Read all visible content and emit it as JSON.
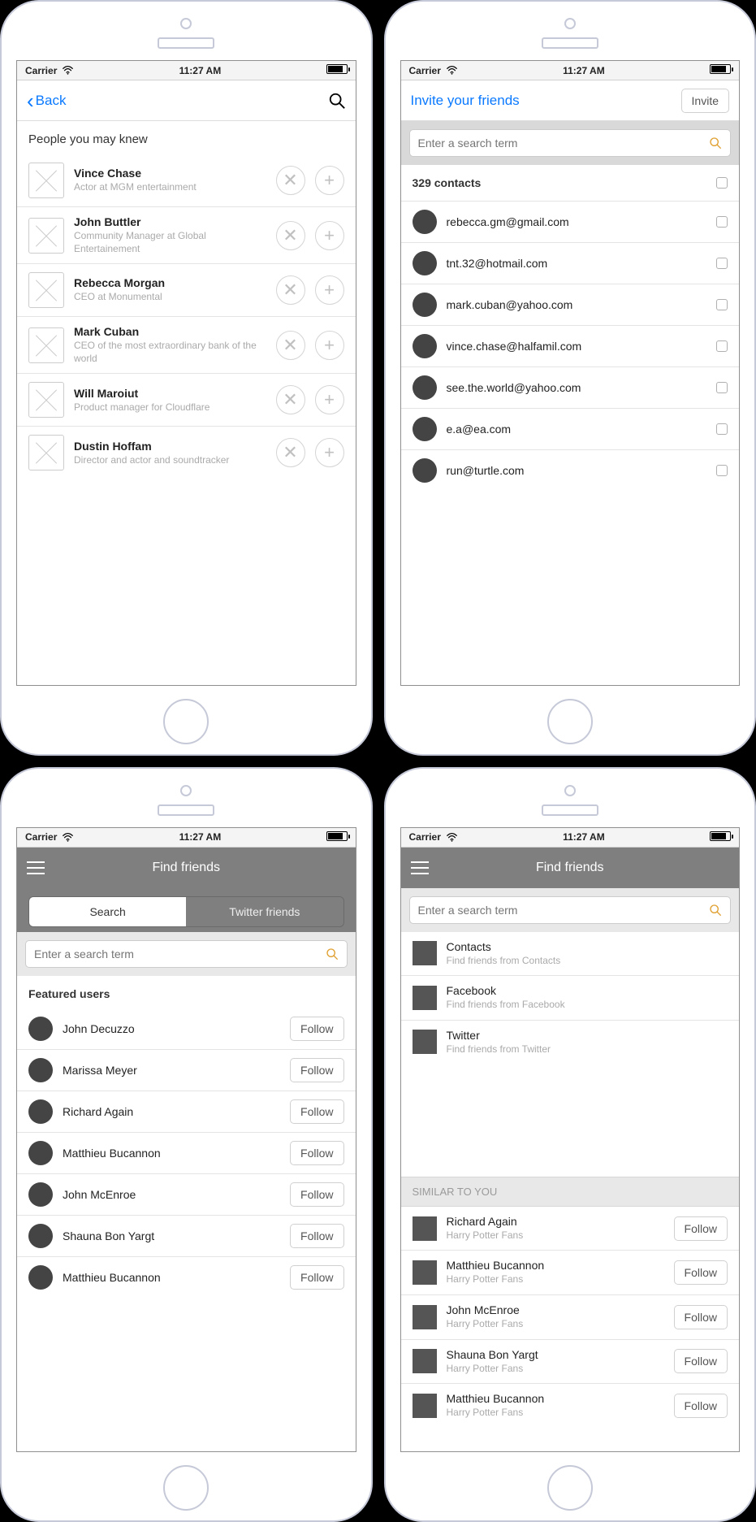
{
  "status": {
    "carrier": "Carrier",
    "time": "11:27 AM"
  },
  "screen1": {
    "back_label": "Back",
    "heading": "People you may knew",
    "people": [
      {
        "name": "Vince Chase",
        "sub": "Actor at MGM entertainment"
      },
      {
        "name": "John Buttler",
        "sub": "Community Manager at Global Entertainement"
      },
      {
        "name": "Rebecca Morgan",
        "sub": "CEO at Monumental"
      },
      {
        "name": "Mark Cuban",
        "sub": "CEO of the most extraordinary bank of the world"
      },
      {
        "name": "Will Maroiut",
        "sub": "Product manager for Cloudflare"
      },
      {
        "name": "Dustin Hoffam",
        "sub": "Director and actor and soundtracker"
      }
    ]
  },
  "screen2": {
    "title": "Invite your friends",
    "invite_label": "Invite",
    "search_placeholder": "Enter a search term",
    "contacts_header": "329 contacts",
    "contacts": [
      "rebecca.gm@gmail.com",
      "tnt.32@hotmail.com",
      "mark.cuban@yahoo.com",
      "vince.chase@halfamil.com",
      "see.the.world@yahoo.com",
      "e.a@ea.com",
      "run@turtle.com"
    ]
  },
  "screen3": {
    "title": "Find friends",
    "tab_search": "Search",
    "tab_twitter": "Twitter friends",
    "search_placeholder": "Enter a search term",
    "featured_heading": "Featured users",
    "follow_label": "Follow",
    "users": [
      "John Decuzzo",
      "Marissa Meyer",
      "Richard Again",
      "Matthieu Bucannon",
      "John McEnroe",
      "Shauna Bon Yargt",
      "Matthieu Bucannon"
    ]
  },
  "screen4": {
    "title": "Find friends",
    "search_placeholder": "Enter a search term",
    "sources": [
      {
        "name": "Contacts",
        "sub": "Find friends from Contacts"
      },
      {
        "name": "Facebook",
        "sub": "Find friends from Facebook"
      },
      {
        "name": "Twitter",
        "sub": "Find friends from Twitter"
      }
    ],
    "similar_heading": "SIMILAR TO YOU",
    "follow_label": "Follow",
    "similar": [
      {
        "name": "Richard Again",
        "sub": "Harry Potter Fans"
      },
      {
        "name": "Matthieu Bucannon",
        "sub": "Harry Potter Fans"
      },
      {
        "name": "John McEnroe",
        "sub": "Harry Potter Fans"
      },
      {
        "name": "Shauna Bon Yargt",
        "sub": "Harry Potter Fans"
      },
      {
        "name": "Matthieu Bucannon",
        "sub": "Harry Potter Fans"
      }
    ]
  }
}
